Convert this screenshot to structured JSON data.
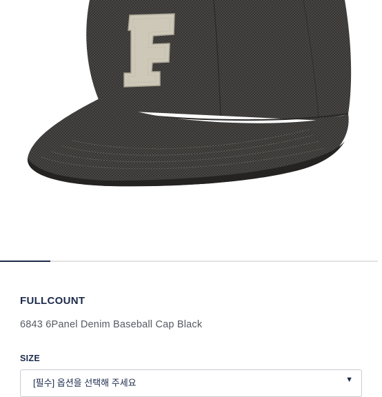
{
  "product": {
    "brand": "FULLCOUNT",
    "name": "6843 6Panel Denim Baseball Cap Black",
    "image_icon": "denim-cap-photo",
    "cap_letter": "F"
  },
  "carousel": {
    "active_index": 0
  },
  "options": {
    "size_label": "SIZE",
    "size_placeholder": "[필수] 옵션을 선택해 주세요",
    "chevron_icon": "chevron-down-icon"
  },
  "colors": {
    "brand_navy": "#1b2a4a",
    "denim": "#3a3836"
  }
}
